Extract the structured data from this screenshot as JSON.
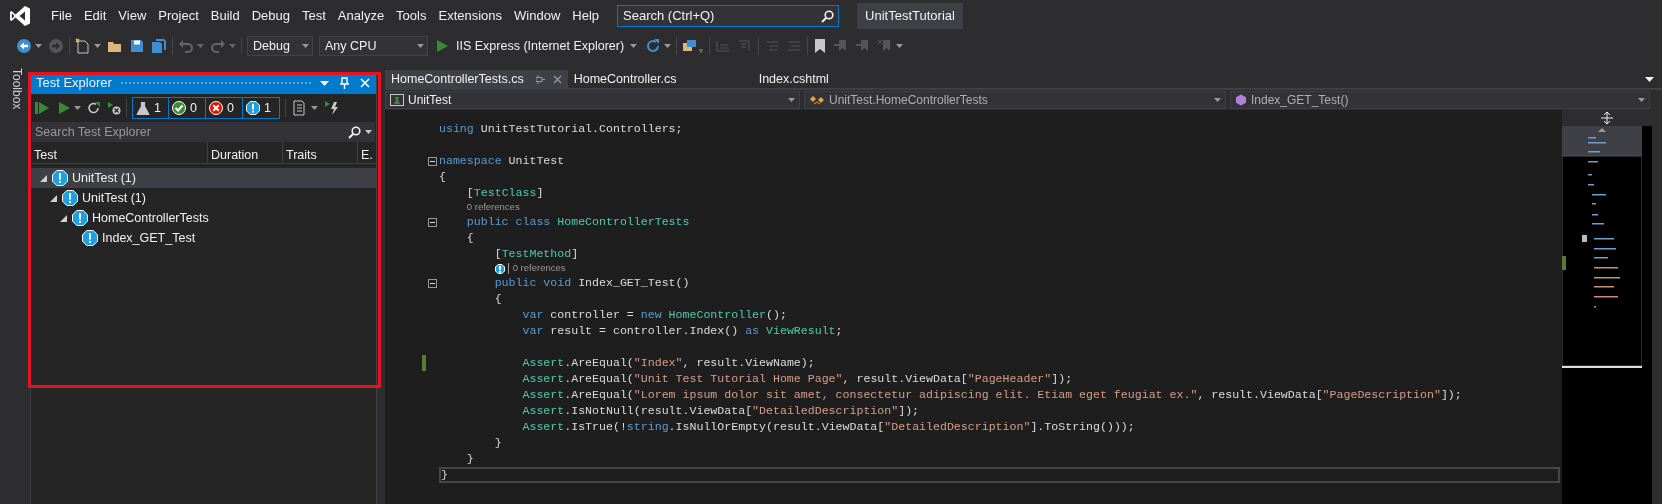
{
  "menu": [
    "File",
    "Edit",
    "View",
    "Project",
    "Build",
    "Debug",
    "Test",
    "Analyze",
    "Tools",
    "Extensions",
    "Window",
    "Help"
  ],
  "search": {
    "placeholder": "Search (Ctrl+Q)"
  },
  "solution_title": "UnitTestTutorial",
  "toolbar": {
    "configuration": "Debug",
    "platform": "Any CPU",
    "run_target": "IIS Express (Internet Explorer)"
  },
  "side_tabs": [
    "Toolbox"
  ],
  "test_explorer": {
    "title": "Test Explorer",
    "highlighted": true,
    "counters": [
      {
        "kind": "total",
        "count": "1"
      },
      {
        "kind": "passed",
        "count": "0"
      },
      {
        "kind": "failed",
        "count": "0"
      },
      {
        "kind": "not_run",
        "count": "1"
      }
    ],
    "search": {
      "placeholder": "Search Test Explorer"
    },
    "columns": [
      "Test",
      "Duration",
      "Traits",
      "E."
    ],
    "tree": [
      {
        "label": "UnitTest (1)",
        "kind": "not_run",
        "expanded": true,
        "selected": true,
        "children": [
          {
            "label": "UnitTest (1)",
            "kind": "not_run",
            "expanded": true,
            "selected": false,
            "children": [
              {
                "label": "HomeControllerTests",
                "kind": "not_run",
                "expanded": true,
                "selected": false,
                "children": [
                  {
                    "label": "Index_GET_Test",
                    "kind": "not_run",
                    "selected": false
                  }
                ]
              }
            ]
          }
        ]
      }
    ]
  },
  "editor": {
    "tabs": [
      {
        "label": "HomeControllerTests.cs",
        "selected": true
      },
      {
        "label": "HomeController.cs",
        "selected": false
      },
      {
        "label": "Index.cshtml",
        "selected": false
      }
    ],
    "nav": [
      {
        "kind": "project",
        "label": "UnitTest"
      },
      {
        "kind": "class",
        "label": "UnitTest.HomeControllerTests"
      },
      {
        "kind": "member",
        "label": "Index_GET_Test()"
      }
    ],
    "lines": [
      {
        "kind": "code",
        "changed": false,
        "tokens": [
          {
            "kind": "kw",
            "text": "using"
          },
          {
            "kind": "plain",
            "text": " UnitTestTutorial.Controllers;"
          }
        ]
      },
      {
        "kind": "blank",
        "changed": false
      },
      {
        "kind": "code",
        "changed": false,
        "expanded": true,
        "tokens": [
          {
            "kind": "kw",
            "text": "namespace"
          },
          {
            "kind": "plain",
            "text": " UnitTest"
          }
        ]
      },
      {
        "kind": "code",
        "changed": false,
        "tokens": [
          {
            "kind": "plain",
            "text": "{"
          }
        ]
      },
      {
        "kind": "code",
        "changed": false,
        "tokens": [
          {
            "kind": "plain",
            "text": "    ["
          },
          {
            "kind": "type",
            "text": "TestClass"
          },
          {
            "kind": "plain",
            "text": "]"
          }
        ]
      },
      {
        "kind": "codelens",
        "text": "0 references"
      },
      {
        "kind": "code",
        "changed": false,
        "expanded": true,
        "tokens": [
          {
            "kind": "kw",
            "text": "    public class"
          },
          {
            "kind": "type",
            "text": " HomeControllerTests"
          }
        ]
      },
      {
        "kind": "code",
        "changed": false,
        "tokens": [
          {
            "kind": "plain",
            "text": "    {"
          }
        ]
      },
      {
        "kind": "code",
        "changed": false,
        "tokens": [
          {
            "kind": "plain",
            "text": "        ["
          },
          {
            "kind": "type",
            "text": "TestMethod"
          },
          {
            "kind": "plain",
            "text": "]"
          }
        ]
      },
      {
        "kind": "codelens",
        "text": "0 references",
        "test": {
          "kind": "not_run"
        }
      },
      {
        "kind": "code",
        "changed": false,
        "expanded": true,
        "tokens": [
          {
            "kind": "kw",
            "text": "        public void"
          },
          {
            "kind": "plain",
            "text": " Index_GET_Test()"
          }
        ]
      },
      {
        "kind": "code",
        "changed": false,
        "tokens": [
          {
            "kind": "plain",
            "text": "        {"
          }
        ]
      },
      {
        "kind": "code",
        "changed": false,
        "tokens": [
          {
            "kind": "kw",
            "text": "            var"
          },
          {
            "kind": "plain",
            "text": " controller = "
          },
          {
            "kind": "kw",
            "text": "new"
          },
          {
            "kind": "type",
            "text": " HomeController"
          },
          {
            "kind": "plain",
            "text": "();"
          }
        ]
      },
      {
        "kind": "code",
        "changed": false,
        "tokens": [
          {
            "kind": "kw",
            "text": "            var"
          },
          {
            "kind": "plain",
            "text": " result = controller.Index() "
          },
          {
            "kind": "kw",
            "text": "as"
          },
          {
            "kind": "type",
            "text": " ViewResult"
          },
          {
            "kind": "plain",
            "text": ";"
          }
        ]
      },
      {
        "kind": "blank",
        "changed": false
      },
      {
        "kind": "code",
        "changed": true,
        "tokens": [
          {
            "kind": "type",
            "text": "            Assert"
          },
          {
            "kind": "plain",
            "text": ".AreEqual("
          },
          {
            "kind": "str",
            "text": "\"Index\""
          },
          {
            "kind": "plain",
            "text": ", result.ViewName);"
          }
        ]
      },
      {
        "kind": "code",
        "changed": false,
        "tokens": [
          {
            "kind": "type",
            "text": "            Assert"
          },
          {
            "kind": "plain",
            "text": ".AreEqual("
          },
          {
            "kind": "str",
            "text": "\"Unit Test Tutorial Home Page\""
          },
          {
            "kind": "plain",
            "text": ", result.ViewData["
          },
          {
            "kind": "str",
            "text": "\"PageHeader\""
          },
          {
            "kind": "plain",
            "text": "]);"
          }
        ]
      },
      {
        "kind": "code",
        "changed": false,
        "tokens": [
          {
            "kind": "type",
            "text": "            Assert"
          },
          {
            "kind": "plain",
            "text": ".AreEqual("
          },
          {
            "kind": "str",
            "text": "\"Lorem ipsum dolor sit amet, consectetur adipiscing elit. Etiam eget feugiat ex.\""
          },
          {
            "kind": "plain",
            "text": ", result.ViewData["
          },
          {
            "kind": "str",
            "text": "\"PageDescription\""
          },
          {
            "kind": "plain",
            "text": "]);"
          }
        ]
      },
      {
        "kind": "code",
        "changed": false,
        "tokens": [
          {
            "kind": "type",
            "text": "            Assert"
          },
          {
            "kind": "plain",
            "text": ".IsNotNull(result.ViewData["
          },
          {
            "kind": "str",
            "text": "\"DetailedDescription\""
          },
          {
            "kind": "plain",
            "text": "]);"
          }
        ]
      },
      {
        "kind": "code",
        "changed": false,
        "tokens": [
          {
            "kind": "type",
            "text": "            Assert"
          },
          {
            "kind": "plain",
            "text": ".IsTrue(!"
          },
          {
            "kind": "kw",
            "text": "string"
          },
          {
            "kind": "plain",
            "text": ".IsNullOrEmpty(result.ViewData["
          },
          {
            "kind": "str",
            "text": "\"DetailedDescription\""
          },
          {
            "kind": "plain",
            "text": "].ToString()));"
          }
        ]
      },
      {
        "kind": "code",
        "changed": false,
        "tokens": [
          {
            "kind": "plain",
            "text": "        }"
          }
        ]
      },
      {
        "kind": "code",
        "changed": false,
        "tokens": [
          {
            "kind": "plain",
            "text": "    }"
          }
        ]
      },
      {
        "kind": "code",
        "changed": false,
        "current": true,
        "tokens": [
          {
            "kind": "plain",
            "text": "}"
          }
        ]
      }
    ]
  }
}
